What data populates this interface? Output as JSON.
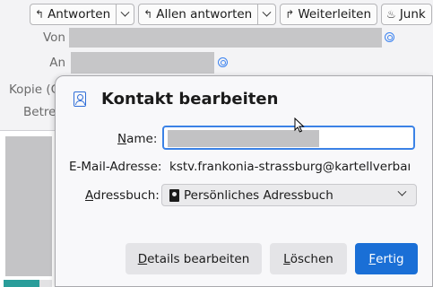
{
  "toolbar": {
    "reply_label": "Antworten",
    "reply_all_label": "Allen antworten",
    "forward_label": "Weiterleiten",
    "junk_label": "Junk"
  },
  "header": {
    "from_label": "Von",
    "to_label": "An",
    "cc_label": "Kopie (C",
    "subject_label": "Betre"
  },
  "dialog": {
    "title": "Kontakt bearbeiten",
    "name_label_access": "N",
    "name_label_rest": "ame:",
    "name_value": "",
    "email_label": "E-Mail-Adresse:",
    "email_value": "kstv.frankonia-strassburg@kartellverband.de",
    "addressbook_label_access": "A",
    "addressbook_label_rest": "dressbuch:",
    "addressbook_value": "Persönliches Adressbuch",
    "details_button_access": "D",
    "details_button_rest": "etails bearbeiten",
    "delete_button_access": "L",
    "delete_button_rest": "öschen",
    "done_button_access": "F",
    "done_button_rest": "ertig"
  },
  "icons": {
    "reply": "reply-icon",
    "reply_all": "reply-all-icon",
    "forward": "forward-icon",
    "junk": "junk-flame-icon",
    "contact": "address-card-icon",
    "address_book": "address-book-icon"
  },
  "colors": {
    "accent": "#1a6fd6",
    "focus_ring": "#3b82e6",
    "redaction": "#c4c4c6"
  }
}
